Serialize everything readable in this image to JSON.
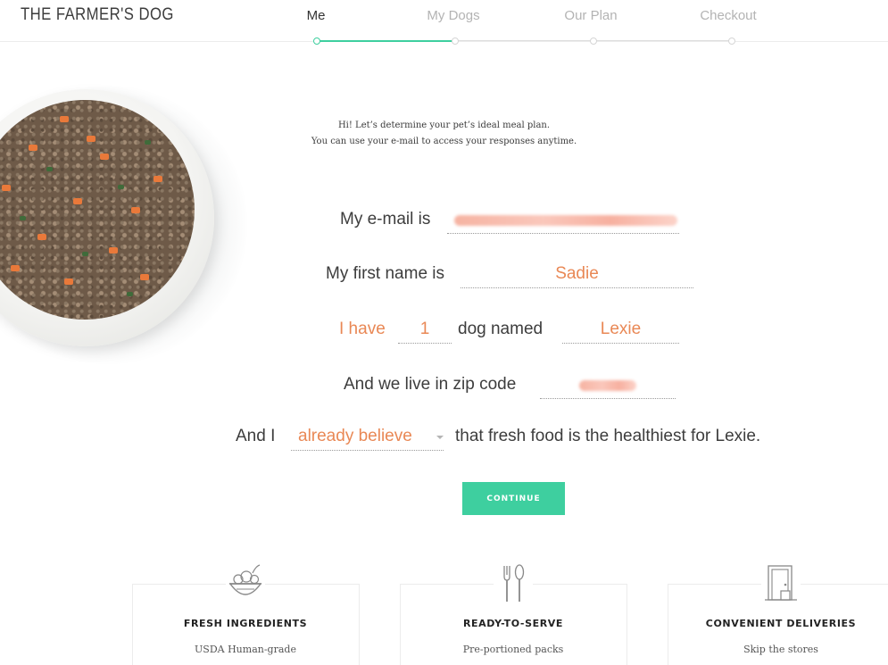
{
  "header": {
    "logo": "THE FARMER'S DOG",
    "steps": [
      {
        "label": "Me",
        "active": true
      },
      {
        "label": "My Dogs",
        "active": false
      },
      {
        "label": "Our Plan",
        "active": false
      },
      {
        "label": "Checkout",
        "active": false
      }
    ],
    "progress": 0.333
  },
  "intro": {
    "line1": "Hi! Let’s determine your pet’s ideal meal plan.",
    "line2": "You can use your e-mail to access your responses anytime."
  },
  "form": {
    "email_label": "My e-mail is",
    "email_value": "",
    "first_name_label": "My first name is",
    "first_name_value": "Sadie",
    "have_label": "I have",
    "dog_count": "1",
    "dog_named_label": "dog named",
    "dog_name": "Lexie",
    "zip_label": "And we live in zip code",
    "zip_value": "",
    "belief_prefix": "And I",
    "belief_value": "already believe",
    "belief_suffix": "that fresh food is the healthiest for Lexie."
  },
  "continue_label": "CONTINUE",
  "features": [
    {
      "icon": "salad-bowl-icon",
      "title": "FRESH INGREDIENTS",
      "subtitle": "USDA Human-grade"
    },
    {
      "icon": "fork-spoon-icon",
      "title": "READY-TO-SERVE",
      "subtitle": "Pre-portioned packs"
    },
    {
      "icon": "door-delivery-icon",
      "title": "CONVENIENT DELIVERIES",
      "subtitle": "Skip the stores"
    }
  ],
  "colors": {
    "accent": "#3ecf9f",
    "input_text": "#e98855"
  }
}
